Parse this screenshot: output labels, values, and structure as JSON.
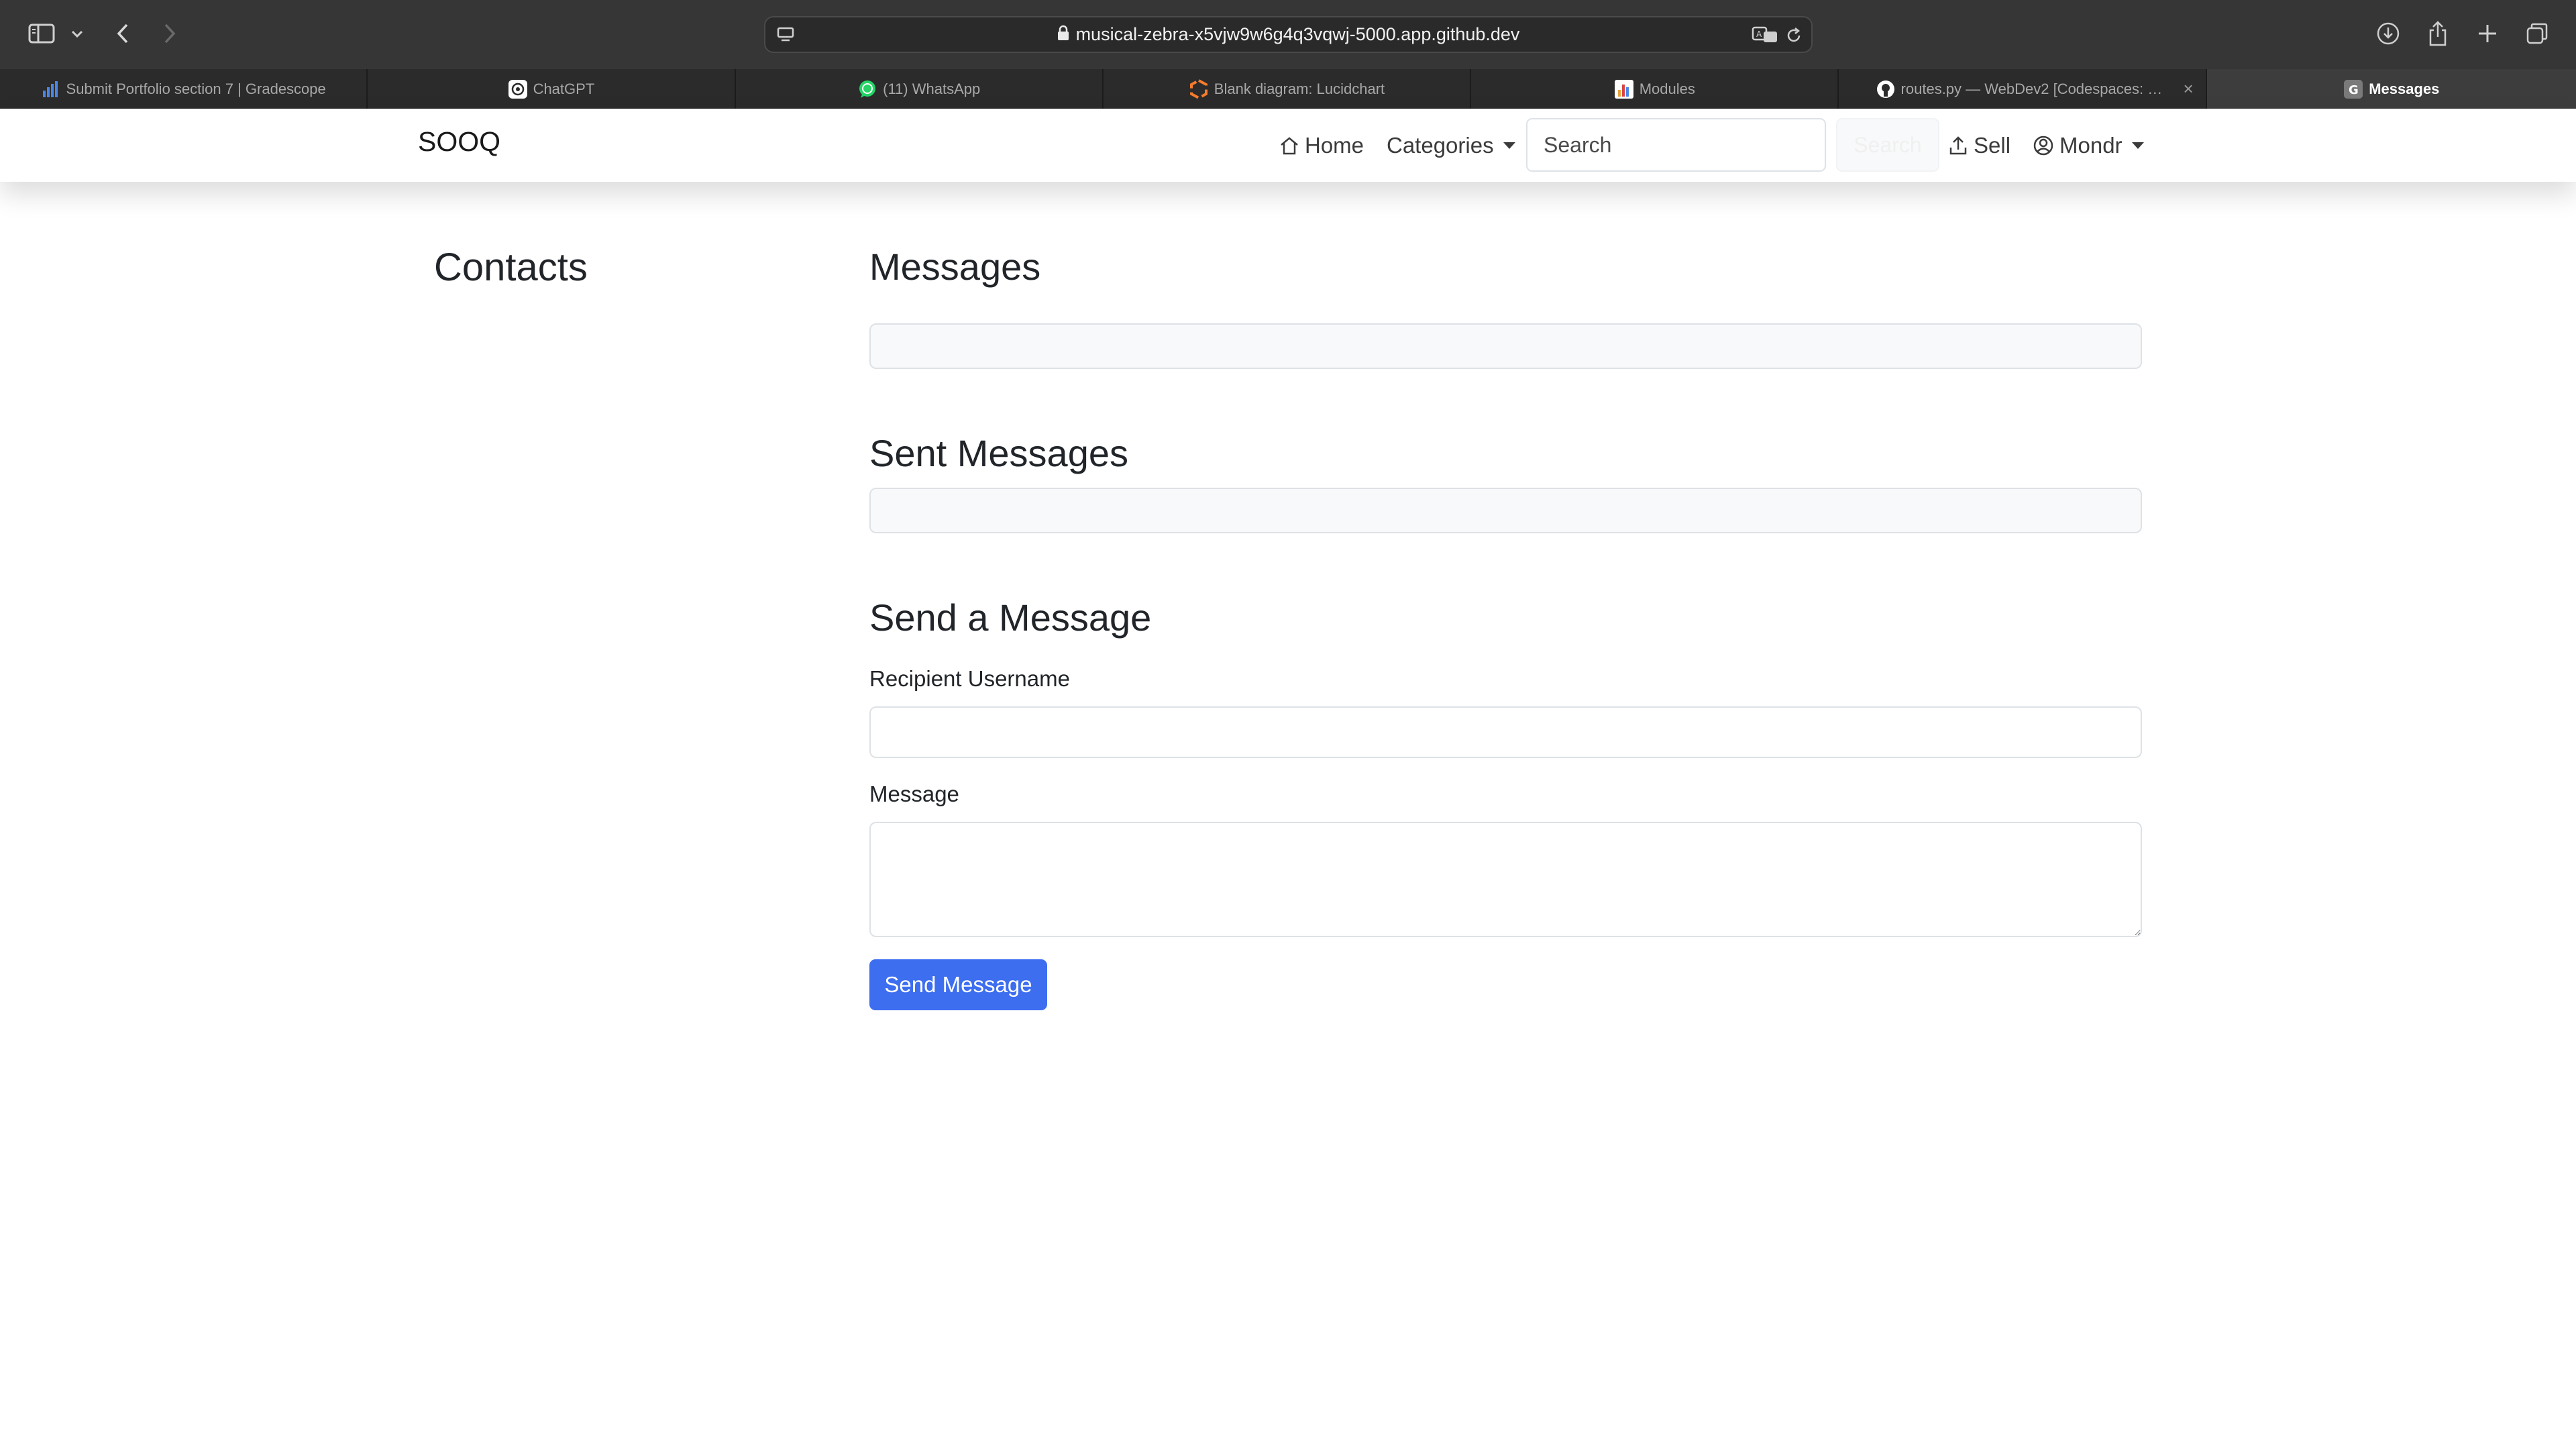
{
  "browser": {
    "url": "musical-zebra-x5vjw9w6g4q3vqwj-5000.app.github.dev",
    "tabs": [
      {
        "label": "Submit Portfolio section 7 | Gradescope"
      },
      {
        "label": "ChatGPT"
      },
      {
        "label": "(11) WhatsApp"
      },
      {
        "label": "Blank diagram: Lucidchart"
      },
      {
        "label": "Modules"
      },
      {
        "label": "routes.py — WebDev2 [Codespaces: mus..."
      },
      {
        "label": "Messages",
        "icon_letter": "G"
      }
    ]
  },
  "navbar": {
    "brand": "SOOQ",
    "home": "Home",
    "categories": "Categories",
    "search_placeholder": "Search",
    "search_button": "Search",
    "sell": "Sell",
    "user": "Mondr"
  },
  "contacts": {
    "title": "Contacts"
  },
  "messages": {
    "title": "Messages"
  },
  "sent": {
    "title": "Sent Messages"
  },
  "compose": {
    "title": "Send a Message",
    "recipient_label": "Recipient Username",
    "recipient_value": "",
    "message_label": "Message",
    "message_value": "",
    "submit": "Send Message"
  }
}
